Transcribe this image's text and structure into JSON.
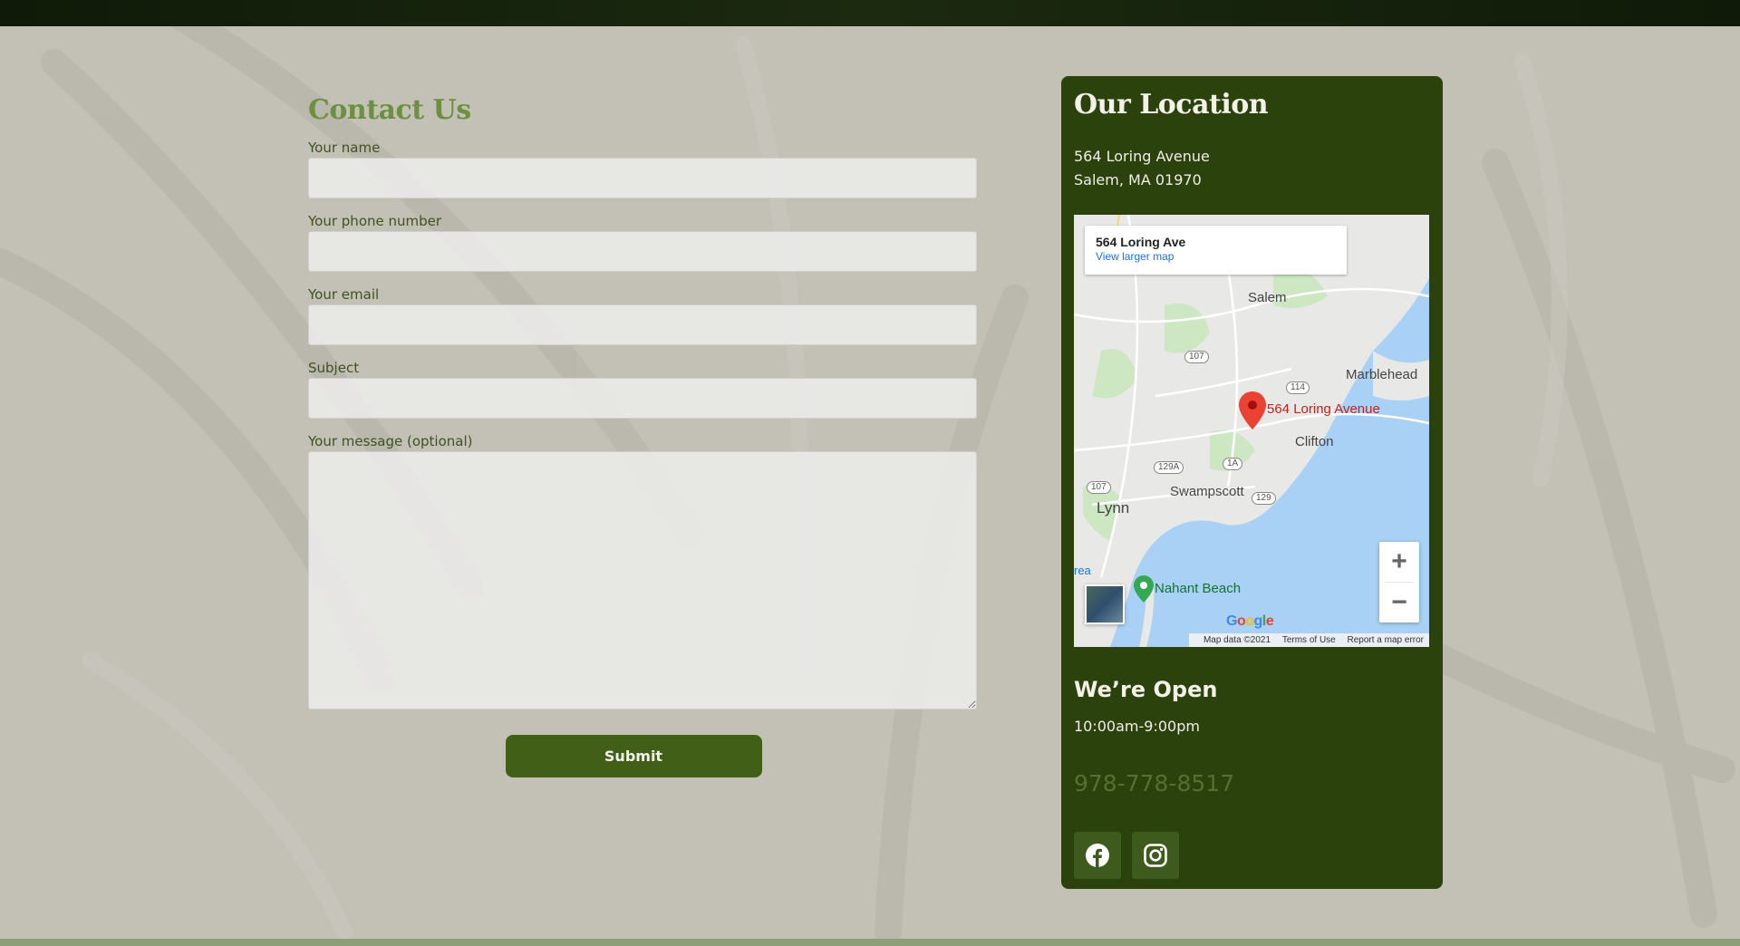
{
  "contact": {
    "title": "Contact Us",
    "fields": [
      {
        "label": "Your name",
        "value": ""
      },
      {
        "label": "Your phone number",
        "value": ""
      },
      {
        "label": "Your email",
        "value": ""
      },
      {
        "label": "Subject",
        "value": ""
      },
      {
        "label": "Your message (optional)",
        "value": ""
      }
    ],
    "submit_label": "Submit"
  },
  "location": {
    "title": "Our Location",
    "address_line1": "564 Loring Avenue",
    "address_line2": "Salem, MA 01970",
    "map": {
      "info_title": "564 Loring Ave",
      "info_link": "View larger map",
      "pin_label": "564 Loring Avenue",
      "labels": {
        "salem": "Salem",
        "marblehead": "Marblehead",
        "clifton": "Clifton",
        "swampscott": "Swampscott",
        "lynn": "Lynn",
        "nahant_beach": "Nahant Beach",
        "area_fragment": "rea"
      },
      "routes": {
        "r107a": "107",
        "r114": "114",
        "r129a": "129A",
        "r1a": "1A",
        "r107b": "107",
        "r129": "129"
      },
      "zoom_in": "+",
      "zoom_out": "−",
      "footer": {
        "data": "Map data ©2021",
        "terms": "Terms of Use",
        "report": "Report a map error"
      }
    },
    "open_title": "We’re Open",
    "hours": "10:00am-9:00pm",
    "phone": "978-778-8517"
  },
  "colors": {
    "accent_green": "#6b9140",
    "card_bg": "#2b420d",
    "button_bg": "#415f17"
  },
  "icons": [
    "facebook-icon",
    "instagram-icon",
    "map-pin-icon"
  ]
}
